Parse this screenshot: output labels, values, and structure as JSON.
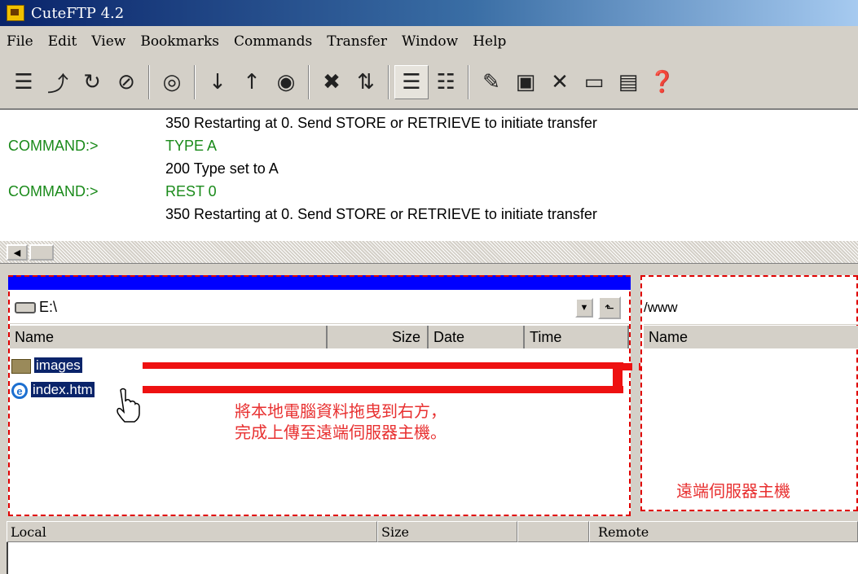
{
  "window": {
    "title": "CuteFTP 4.2"
  },
  "menu": [
    "File",
    "Edit",
    "View",
    "Bookmarks",
    "Commands",
    "Transfer",
    "Window",
    "Help"
  ],
  "toolbar": {
    "groups": [
      [
        "connect-icon",
        "disconnect-icon",
        "reconnect-icon",
        "stop-icon"
      ],
      [
        "quick-connect-icon"
      ],
      [
        "download-icon",
        "upload-icon",
        "queue-transfer-icon"
      ],
      [
        "cancel-icon",
        "refresh-icon"
      ],
      [
        "details-view-icon",
        "list-view-icon"
      ],
      [
        "edit-icon",
        "rename-icon",
        "delete-icon",
        "view-icon",
        "new-folder-icon",
        "help-icon"
      ]
    ]
  },
  "log": [
    {
      "label": "",
      "text": "350 Restarting at 0. Send STORE or RETRIEVE to initiate transfer",
      "type": "response"
    },
    {
      "label": "COMMAND:>",
      "text": "TYPE A",
      "type": "command"
    },
    {
      "label": "",
      "text": "200 Type set to A",
      "type": "response"
    },
    {
      "label": "COMMAND:>",
      "text": "REST 0",
      "type": "command"
    },
    {
      "label": "",
      "text": "350 Restarting at 0. Send STORE or RETRIEVE to initiate transfer",
      "type": "response"
    }
  ],
  "local": {
    "path": "E:\\",
    "columns": {
      "name": "Name",
      "size": "Size",
      "date": "Date",
      "time": "Time"
    },
    "files": [
      {
        "name": "images",
        "type": "folder"
      },
      {
        "name": "index.htm",
        "type": "html"
      }
    ],
    "annotation_line1": "將本地電腦資料拖曳到右方，",
    "annotation_line2": "完成上傳至遠端伺服器主機。"
  },
  "remote": {
    "path": "/www",
    "columns": {
      "name": "Name"
    },
    "annotation": "遠端伺服器主機"
  },
  "queue": {
    "columns": {
      "local": "Local",
      "size": "Size",
      "remote": "Remote"
    }
  },
  "colors": {
    "annotation": "#e00000",
    "command": "#1a8a1a",
    "selection": "#0a246a"
  }
}
